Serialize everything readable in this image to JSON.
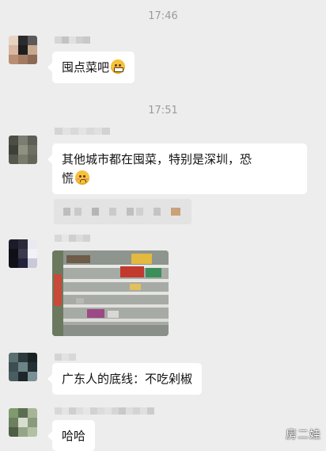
{
  "chat": {
    "time_1": "17:46",
    "time_2": "17:51",
    "messages": [
      {
        "text": "囤点菜吧",
        "emoji": "grinning-face-icon"
      },
      {
        "text": "其他城市都在囤菜，特别是深圳，恐",
        "text2": "慌",
        "emoji": "worried-face-icon"
      },
      {
        "type": "image",
        "description": "supermarket-shelves-photo"
      },
      {
        "text": "广东人的底线：不吃剁椒"
      },
      {
        "text": "哈哈"
      }
    ]
  },
  "watermark": "房二娃",
  "colors": {
    "background": "#ededed",
    "bubble": "#ffffff",
    "timestamp": "#9b9b9b"
  }
}
